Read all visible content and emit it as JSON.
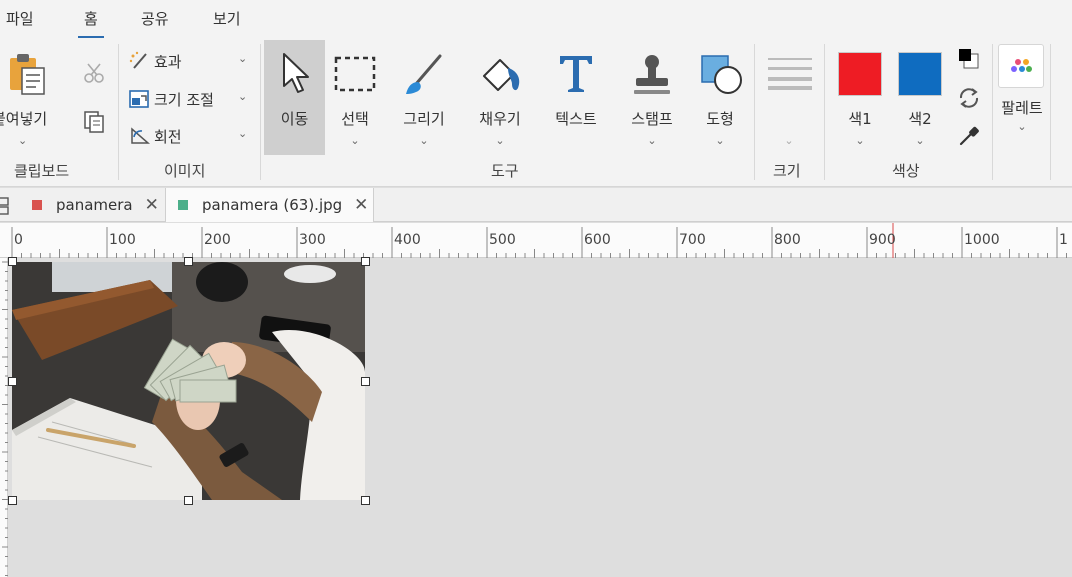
{
  "menu": {
    "file": "파일",
    "home": "홈",
    "share": "공유",
    "view": "보기"
  },
  "clipboard": {
    "paste": "붙여넣기",
    "group_label": "클립보드"
  },
  "image": {
    "effects": "효과",
    "resize": "크기 조절",
    "rotate": "회전",
    "group_label": "이미지"
  },
  "tools": {
    "move": "이동",
    "select": "선택",
    "draw": "그리기",
    "fill": "채우기",
    "text": "텍스트",
    "stamp": "스탬프",
    "shape": "도형",
    "group_label": "도구"
  },
  "size": {
    "group_label": "크기"
  },
  "colors": {
    "color1_label": "색1",
    "color2_label": "색2",
    "color1": "#ee1c24",
    "color2": "#0f6cc0",
    "group_label": "색상"
  },
  "palette": {
    "label": "팔레트"
  },
  "tabs": [
    {
      "label": "panamera",
      "color": "#d9534f",
      "close": "✕"
    },
    {
      "label": "panamera (63).jpg",
      "color": "#4caf8a",
      "close": "✕"
    }
  ],
  "ruler": {
    "labels": [
      "0",
      "100",
      "200",
      "300",
      "400",
      "500",
      "600",
      "700",
      "800",
      "900",
      "1000",
      "1"
    ]
  }
}
